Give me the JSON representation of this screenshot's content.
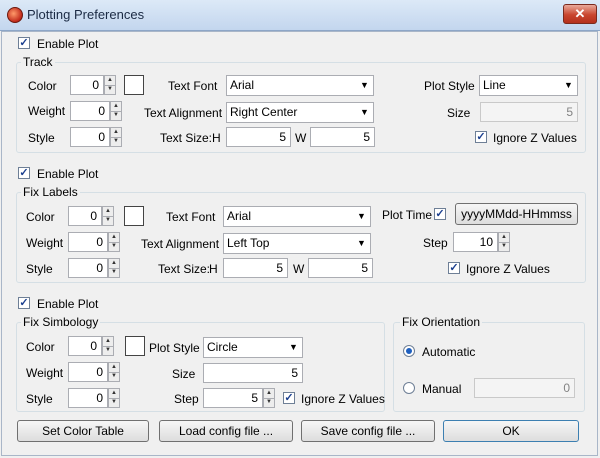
{
  "window": {
    "title": "Plotting Preferences",
    "close": "✕"
  },
  "track": {
    "enable_label": "Enable Plot",
    "enabled": true,
    "group_title": "Track",
    "color_label": "Color",
    "color_value": "0",
    "weight_label": "Weight",
    "weight_value": "0",
    "style_label": "Style",
    "style_value": "0",
    "text_font_label": "Text Font",
    "text_font_value": "Arial",
    "text_alignment_label": "Text Alignment",
    "text_alignment_value": "Right Center",
    "text_size_label": "Text Size:",
    "h_label": "H",
    "h_value": "5",
    "w_label": "W",
    "w_value": "5",
    "plot_style_label": "Plot Style",
    "plot_style_value": "Line",
    "size_label": "Size",
    "size_value": "5",
    "ignore_z_label": "Ignore Z Values",
    "ignore_z": true
  },
  "fix_labels": {
    "enable_label": "Enable Plot",
    "enabled": true,
    "group_title": "Fix Labels",
    "color_label": "Color",
    "color_value": "0",
    "weight_label": "Weight",
    "weight_value": "0",
    "style_label": "Style",
    "style_value": "0",
    "text_font_label": "Text Font",
    "text_font_value": "Arial",
    "text_alignment_label": "Text Alignment",
    "text_alignment_value": "Left Top",
    "text_size_label": "Text Size:",
    "h_label": "H",
    "h_value": "5",
    "w_label": "W",
    "w_value": "5",
    "plot_time_label": "Plot Time",
    "plot_time": true,
    "time_format_button": "yyyyMMdd-HHmmss",
    "step_label": "Step",
    "step_value": "10",
    "ignore_z_label": "Ignore Z Values",
    "ignore_z": true
  },
  "fix_symbology": {
    "enable_label": "Enable Plot",
    "enabled": true,
    "group_title": "Fix Simbology",
    "color_label": "Color",
    "color_value": "0",
    "plot_style_label": "Plot Style",
    "plot_style_value": "Circle",
    "weight_label": "Weight",
    "weight_value": "0",
    "size_label": "Size",
    "size_value": "5",
    "style_label": "Style",
    "style_value": "0",
    "step_label": "Step",
    "step_value": "5",
    "ignore_z_label": "Ignore Z Values",
    "ignore_z": true
  },
  "fix_orientation": {
    "group_title": "Fix Orientation",
    "automatic_label": "Automatic",
    "automatic": true,
    "manual_label": "Manual",
    "manual_value": "0"
  },
  "buttons": {
    "set_color_table": "Set Color Table",
    "load_config": "Load config file ...",
    "save_config": "Save config file ...",
    "ok": "OK"
  },
  "check_mark": "✓"
}
